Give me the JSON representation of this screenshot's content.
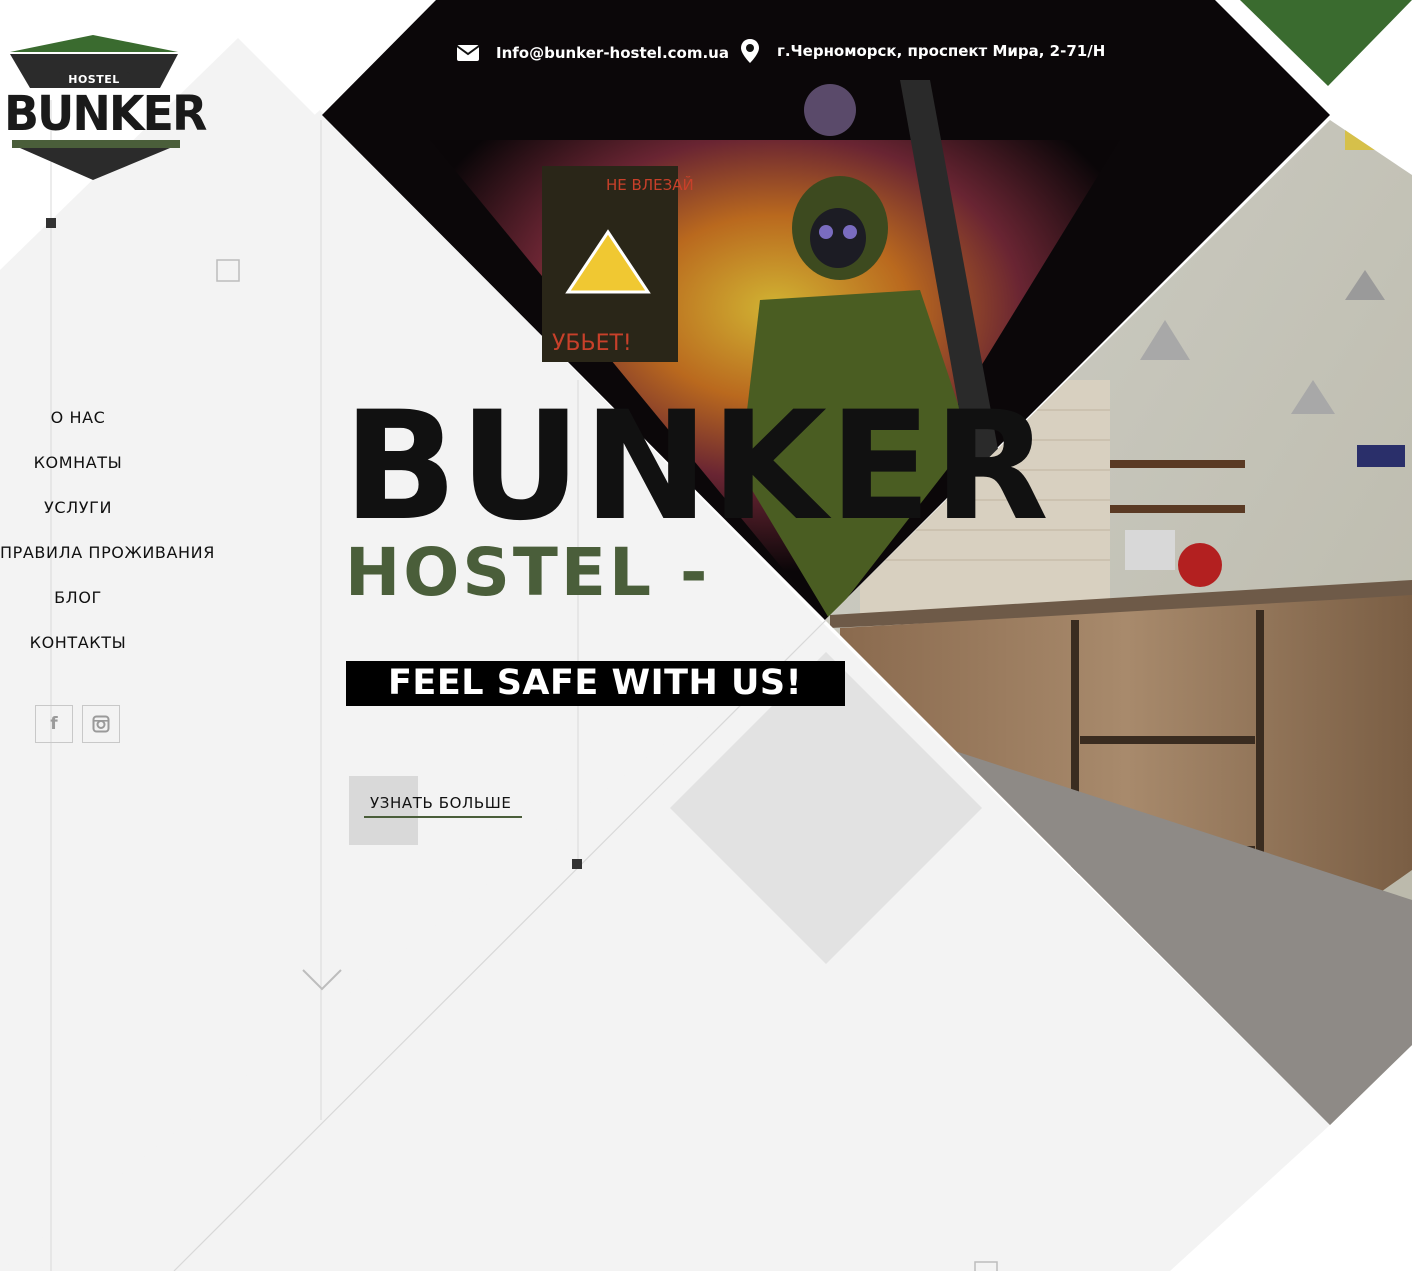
{
  "brand": {
    "logo_word": "BUNKER",
    "logo_badge": "HOSTEL"
  },
  "header": {
    "email": "Info@bunker-hostel.com.ua",
    "address": "г.Черноморск, проспект Мира, 2-71/Н"
  },
  "nav": {
    "items": [
      {
        "label": "О НАС"
      },
      {
        "label": "КОМНАТЫ"
      },
      {
        "label": "УСЛУГИ"
      },
      {
        "label": "ПРАВИЛА ПРОЖИВАНИЯ"
      },
      {
        "label": "БЛОГ"
      },
      {
        "label": "КОНТАКТЫ"
      }
    ]
  },
  "social": {
    "facebook_glyph": "f",
    "instagram_icon": "instagram-icon"
  },
  "hero": {
    "title": "BUNKER",
    "subtitle": "HOSTEL -",
    "slogan": "FEEL SAFE WITH US!",
    "cta_label": "УЗНАТЬ БОЛЬШЕ"
  },
  "colors": {
    "accent_green": "#4a5e3a",
    "dark_green": "#3a6b2f",
    "panel_gray": "#f3f3f3",
    "text_dark": "#111111"
  }
}
